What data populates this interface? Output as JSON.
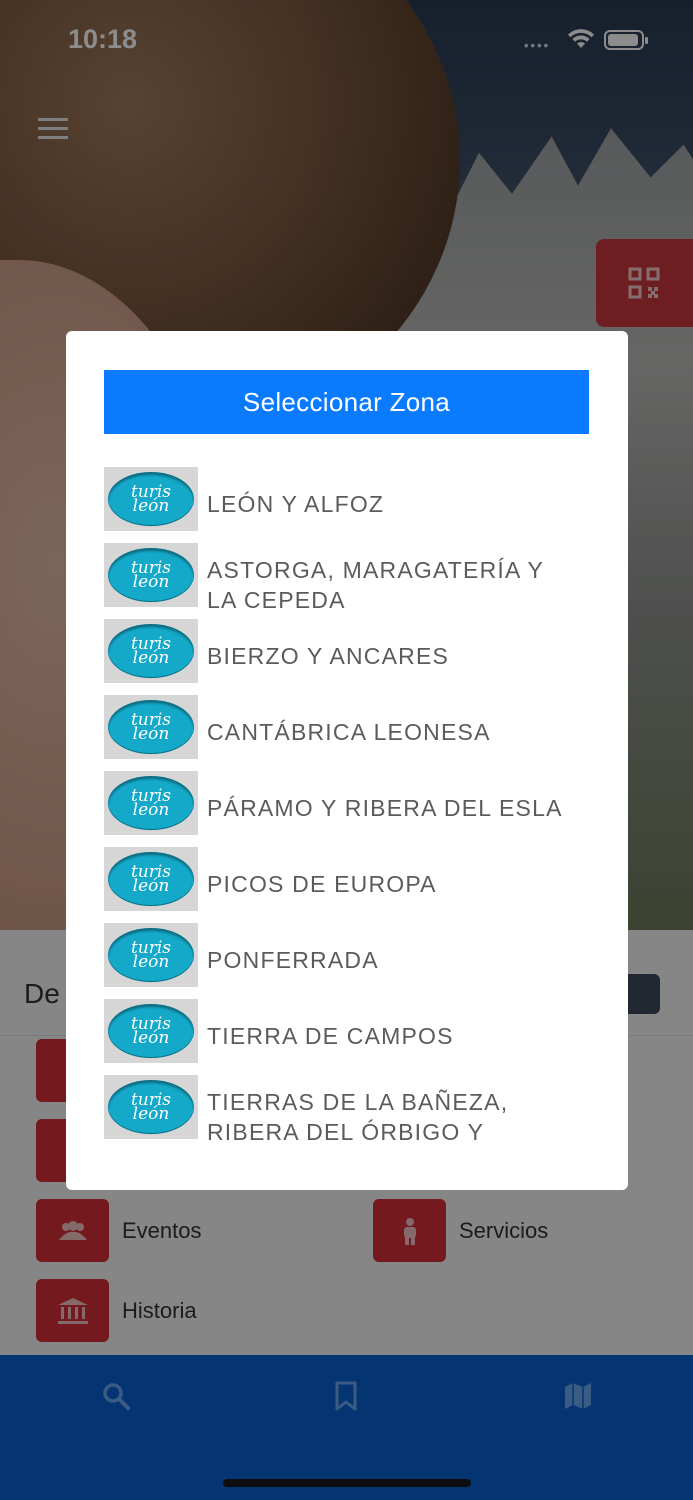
{
  "status_bar": {
    "time": "10:18"
  },
  "content": {
    "section_title": "De",
    "categories": [
      {
        "label": "Eventos",
        "icon": "people-icon"
      },
      {
        "label": "Servicios",
        "icon": "person-icon"
      },
      {
        "label": "Historia",
        "icon": "museum-icon"
      }
    ]
  },
  "tab_bar": {
    "items": [
      {
        "icon": "search-icon"
      },
      {
        "icon": "bookmark-icon"
      },
      {
        "icon": "map-icon"
      }
    ]
  },
  "modal": {
    "title": "Seleccionar Zona",
    "logo_text_top": "turis",
    "logo_text_bottom": "león",
    "zones": [
      "LEÓN Y ALFOZ",
      "ASTORGA, MARAGATERÍA Y LA CEPEDA",
      "BIERZO Y ANCARES",
      "CANTÁBRICA LEONESA",
      "PÁRAMO Y RIBERA DEL ESLA",
      "PICOS DE EUROPA",
      "PONFERRADA",
      "TIERRA DE CAMPOS",
      "TIERRAS DE LA BAÑEZA, RIBERA DEL ÓRBIGO Y"
    ]
  },
  "colors": {
    "primary_blue": "#0a7bff",
    "tab_bar_blue": "#0a5fd0",
    "accent_red": "#d32f35"
  }
}
